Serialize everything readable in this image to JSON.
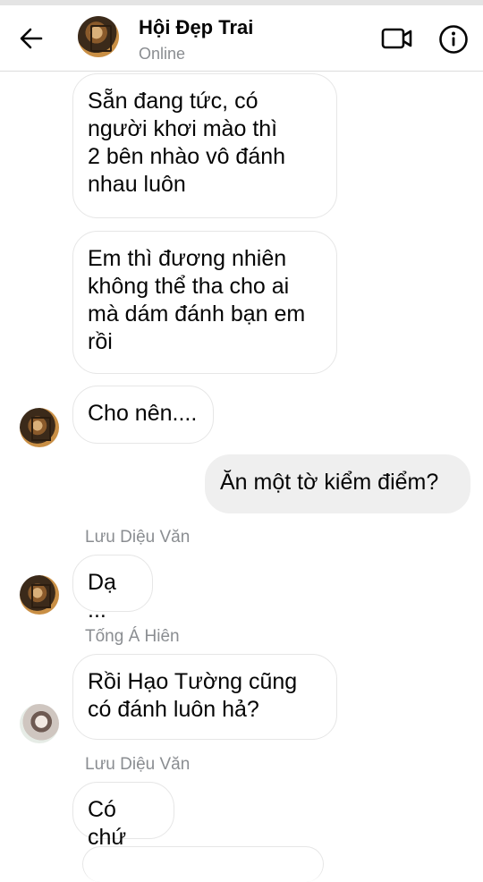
{
  "header": {
    "title": "Hội Đẹp Trai",
    "status": "Online"
  },
  "messages": [
    {
      "text": "Sẵn đang tức, có\nngười khơi mào thì\n2 bên nhào vô đánh\nnhau luôn"
    },
    {
      "text": "Em thì đương nhiên\nkhông thể tha cho ai\nmà dám đánh bạn em\nrồi"
    },
    {
      "text": "Cho nên...."
    },
    {
      "text": "Ăn một tờ kiểm điểm?"
    },
    {
      "sender": "Lưu Diệu Văn",
      "text": "Dạ ..."
    },
    {
      "sender": "Tống Á Hiên",
      "text": "Rồi Hạo Tường cũng\ncó đánh luôn hả?"
    },
    {
      "sender": "Lưu Diệu Văn",
      "text": "Có chứ"
    }
  ]
}
